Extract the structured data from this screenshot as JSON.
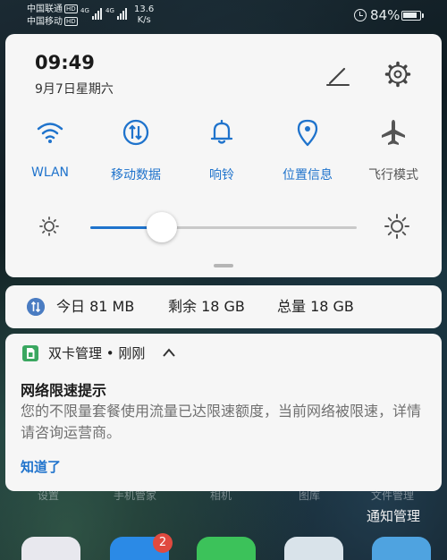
{
  "status_bar": {
    "carrier1": "中国联通",
    "carrier2": "中国移动",
    "hd": "HD",
    "net1": "4G",
    "net2": "4G",
    "speed_value": "13.6",
    "speed_unit": "K/s",
    "battery": "84%"
  },
  "quick_settings": {
    "time": "09:49",
    "date": "9月7日星期六",
    "tiles": [
      {
        "label": "WLAN",
        "icon": "wifi-icon",
        "active": true
      },
      {
        "label": "移动数据",
        "icon": "mobile-data-icon",
        "active": true
      },
      {
        "label": "响铃",
        "icon": "bell-icon",
        "active": true
      },
      {
        "label": "位置信息",
        "icon": "location-icon",
        "active": true
      },
      {
        "label": "飞行模式",
        "icon": "airplane-icon",
        "active": false
      }
    ],
    "brightness": 0.27
  },
  "data_usage": {
    "today": "今日 81 MB",
    "remaining": "剩余 18 GB",
    "total": "总量 18 GB"
  },
  "notification": {
    "app": "双卡管理 • 刚刚",
    "title": "网络限速提示",
    "body": "您的不限量套餐使用流量已达限速额度，当前网络被限速，详情请咨询运营商。",
    "action": "知道了"
  },
  "background": {
    "labels": [
      "设置",
      "手机管家",
      "相机",
      "图库",
      "文件管理"
    ],
    "badge": "2"
  },
  "notification_manage": "通知管理",
  "colors": {
    "accent": "#1f73cc",
    "panel": "#f6f6f6",
    "badge": "#e04a3f"
  }
}
